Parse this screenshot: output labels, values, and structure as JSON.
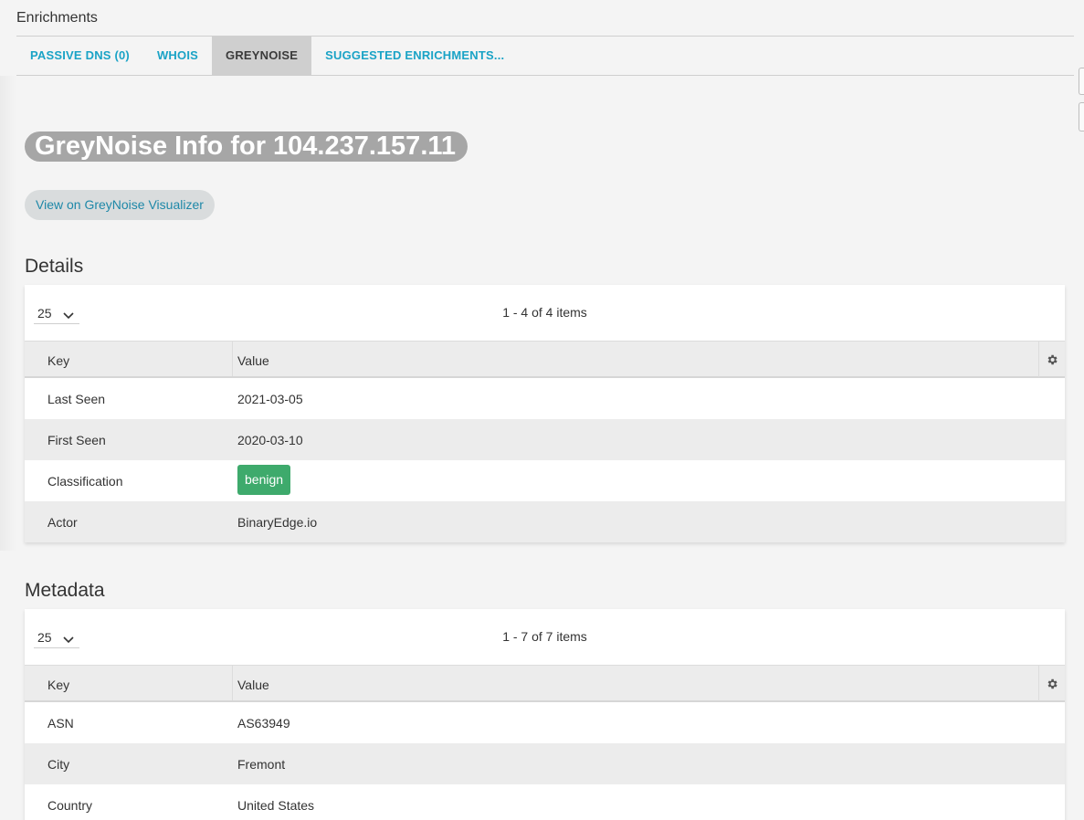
{
  "header": {
    "title": "Enrichments"
  },
  "tabs": [
    {
      "label": "PASSIVE DNS (0)",
      "active": false
    },
    {
      "label": "WHOIS",
      "active": false
    },
    {
      "label": "GREYNOISE",
      "active": true
    },
    {
      "label": "SUGGESTED ENRICHMENTS...",
      "active": false
    }
  ],
  "greynoise": {
    "heading": "GreyNoise Info for 104.237.157.11",
    "visualizer_button": "View on GreyNoise Visualizer"
  },
  "details": {
    "title": "Details",
    "page_size": "25",
    "items_info": "1 - 4 of 4 items",
    "columns": {
      "key": "Key",
      "value": "Value"
    },
    "rows": [
      {
        "key": "Last Seen",
        "value": "2021-03-05"
      },
      {
        "key": "First Seen",
        "value": "2020-03-10"
      },
      {
        "key": "Classification",
        "value": "benign"
      },
      {
        "key": "Actor",
        "value": "BinaryEdge.io"
      }
    ]
  },
  "metadata": {
    "title": "Metadata",
    "page_size": "25",
    "items_info": "1 - 7 of 7 items",
    "columns": {
      "key": "Key",
      "value": "Value"
    },
    "rows": [
      {
        "key": "ASN",
        "value": "AS63949"
      },
      {
        "key": "City",
        "value": "Fremont"
      },
      {
        "key": "Country",
        "value": "United States"
      }
    ]
  },
  "colors": {
    "tab_link": "#1aa3c6",
    "tab_active_bg": "#cfcfcf",
    "heading_bg": "#a6a6a6",
    "benign_badge": "#3eaa6c"
  },
  "icons": {
    "pager": "chevron-down-icon",
    "column_menu": "gear-icon"
  }
}
